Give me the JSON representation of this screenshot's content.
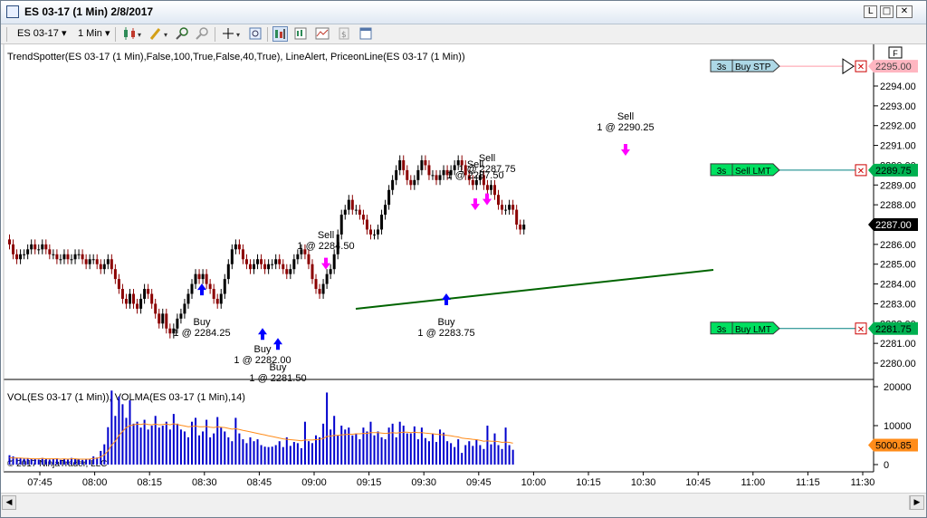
{
  "window": {
    "title": "ES 03-17 (1 Min)  2/8/2017",
    "btn_min": "L",
    "btn_max": "□",
    "btn_close": "✕"
  },
  "toolbar": {
    "instrument": "ES 03-17",
    "interval": "1 Min",
    "dropdown_arrow": "▾",
    "icons": [
      "candlestick-style-icon",
      "pencil-draw-icon",
      "zoom-in-icon",
      "zoom-out-icon",
      "crosshair-icon",
      "magnify-icon",
      "chart-trader-icon",
      "data-box-icon",
      "indicators-icon",
      "strategies-icon",
      "properties-icon"
    ]
  },
  "indicator_label": "TrendSpotter(ES 03-17 (1 Min),False,100,True,False,40,True), LineAlert, PriceonLine(ES 03-17 (1 Min))",
  "volume_label": "VOL(ES 03-17 (1 Min)), VOLMA(ES 03-17 (1 Min),14)",
  "copyright": "© 2017 NinjaTrader, LLC",
  "f_button": "F",
  "price_axis": {
    "ticks": [
      "2294.00",
      "2293.00",
      "2292.00",
      "2291.00",
      "2290.00",
      "2289.00",
      "2288.00",
      "2287.00",
      "2286.00",
      "2285.00",
      "2284.00",
      "2283.00",
      "2282.00",
      "2281.00",
      "2280.00"
    ],
    "last_price": "2287.00",
    "last_price_color": "#000000"
  },
  "volume_axis": {
    "ticks": [
      "20000",
      "10000",
      "0"
    ],
    "volma_value": "5000.85",
    "volma_color": "#ff8c1a"
  },
  "time_axis": [
    "07:45",
    "08:00",
    "08:15",
    "08:30",
    "08:45",
    "09:00",
    "09:15",
    "09:30",
    "09:45",
    "10:00",
    "10:15",
    "10:30",
    "10:45",
    "11:00",
    "11:15",
    "11:30"
  ],
  "orders": [
    {
      "qty": "3s",
      "type": "Buy STP",
      "price": "2295.00",
      "fill": "#add8e6",
      "price_fill": "#ffb6c1"
    },
    {
      "qty": "3s",
      "type": "Sell LMT",
      "price": "2289.75",
      "fill": "#00e060",
      "price_fill": "#00b050"
    },
    {
      "qty": "3s",
      "type": "Buy LMT",
      "price": "2281.75",
      "fill": "#00e060",
      "price_fill": "#00b050"
    }
  ],
  "order_cancel_glyph": "✕",
  "signals": [
    {
      "side": "Buy",
      "text": "1 @ 2284.25"
    },
    {
      "side": "Buy",
      "text": "1 @ 2282.00"
    },
    {
      "side": "Buy",
      "text": "1 @ 2281.50"
    },
    {
      "side": "Sell",
      "text": "1 @ 2284.50"
    },
    {
      "side": "Buy",
      "text": "1 @ 2283.75"
    },
    {
      "side": "Sell",
      "text": "1 @ 2287.50"
    },
    {
      "side": "Sell",
      "text": "1 @ 2287.75"
    },
    {
      "side": "Sell",
      "text": "1 @ 2290.25"
    }
  ],
  "trendline_color": "#006400",
  "up_color": "#000000",
  "down_color": "#8b0000",
  "volume_bar_color": "#0000cd",
  "scroll": {
    "left": "◀",
    "right": "▶"
  },
  "chart_data": {
    "type": "candlestick",
    "x": [
      "07:45",
      "08:00",
      "08:15",
      "08:30",
      "08:45",
      "09:00",
      "09:15",
      "09:30",
      "09:45",
      "10:00",
      "10:15",
      "10:30",
      "10:45",
      "11:00",
      "11:15",
      "11:30"
    ],
    "ylim": [
      2279.5,
      2295.5
    ],
    "close_path": [
      2286.0,
      2285.5,
      2285.25,
      2285.5,
      2285.5,
      2285.75,
      2286.0,
      2285.75,
      2285.75,
      2286.0,
      2285.75,
      2285.5,
      2285.5,
      2285.25,
      2285.25,
      2285.5,
      2285.25,
      2285.25,
      2285.5,
      2285.5,
      2285.25,
      2285.0,
      2285.25,
      2285.25,
      2285.0,
      2284.75,
      2285.0,
      2285.25,
      2284.75,
      2284.25,
      2283.75,
      2283.25,
      2283.0,
      2283.5,
      2283.0,
      2282.75,
      2283.25,
      2283.75,
      2283.5,
      2283.0,
      2282.5,
      2282.0,
      2282.5,
      2281.75,
      2281.5,
      2281.75,
      2282.25,
      2282.5,
      2283.0,
      2283.5,
      2284.0,
      2284.5,
      2284.25,
      2284.5,
      2284.0,
      2283.75,
      2283.25,
      2283.0,
      2283.5,
      2284.25,
      2285.0,
      2285.75,
      2286.0,
      2285.75,
      2285.25,
      2285.0,
      2284.75,
      2285.0,
      2285.25,
      2285.0,
      2284.75,
      2285.0,
      2285.0,
      2285.25,
      2285.0,
      2284.75,
      2284.5,
      2284.75,
      2285.25,
      2285.5,
      2285.75,
      2285.5,
      2285.0,
      2284.25,
      2283.75,
      2283.5,
      2284.0,
      2284.5,
      2284.75,
      2285.5,
      2286.5,
      2287.5,
      2287.75,
      2288.25,
      2287.75,
      2287.75,
      2287.5,
      2287.25,
      2286.75,
      2286.5,
      2286.5,
      2286.75,
      2287.5,
      2288.0,
      2288.75,
      2289.25,
      2289.75,
      2290.25,
      2289.75,
      2289.25,
      2289.0,
      2289.25,
      2289.75,
      2290.25,
      2290.0,
      2289.5,
      2289.5,
      2289.25,
      2289.5,
      2289.75,
      2289.5,
      2289.75,
      2290.0,
      2290.25,
      2290.0,
      2289.5,
      2289.25,
      2289.0,
      2289.25,
      2289.5,
      2289.0,
      2288.75,
      2289.0,
      2288.5,
      2288.0,
      2287.75,
      2287.75,
      2288.0,
      2287.75,
      2287.0,
      2286.75,
      2287.0
    ],
    "volume_path": [
      2400,
      2100,
      1800,
      1700,
      1500,
      1600,
      1400,
      1500,
      1300,
      1700,
      1400,
      1300,
      1500,
      1600,
      1200,
      1400,
      1300,
      1700,
      1500,
      1400,
      1200,
      1300,
      1400,
      2100,
      1800,
      3500,
      5200,
      9600,
      19000,
      12500,
      17500,
      15500,
      12000,
      16500,
      10500,
      11000,
      9500,
      11500,
      9000,
      10000,
      12500,
      9500,
      10000,
      11000,
      9000,
      13000,
      10500,
      9000,
      8500,
      7000,
      11000,
      12000,
      7500,
      8500,
      11500,
      7000,
      8000,
      12200,
      9500,
      8500,
      7000,
      6000,
      12000,
      8000,
      6500,
      5500,
      7000,
      6000,
      6500,
      5000,
      4600,
      4500,
      4600,
      5000,
      6000,
      4500,
      7000,
      4800,
      5800,
      5500,
      4200,
      11000,
      6000,
      5500,
      7500,
      7000,
      10500,
      18500,
      9000,
      12500,
      7500,
      10000,
      9000,
      9500,
      7500,
      8000,
      6500,
      9500,
      8500,
      11000,
      7500,
      8500,
      7000,
      6500,
      9500,
      10500,
      7000,
      11000,
      10000,
      8000,
      8000,
      9800,
      6500,
      9500,
      6800,
      6000,
      8000,
      5800,
      9000,
      8200,
      6000,
      5500,
      4500,
      6500,
      3000,
      5000,
      6000,
      4800,
      6500,
      5000,
      4000,
      10000,
      5200,
      8000,
      5000,
      4000,
      9500,
      5000,
      3800
    ],
    "volma_path": [
      1800,
      1700,
      1700,
      1700,
      1600,
      1600,
      1500,
      1500,
      1500,
      1600,
      1500,
      1500,
      1500,
      1500,
      1400,
      1500,
      1400,
      1500,
      1500,
      1400,
      1400,
      1400,
      1400,
      1600,
      1600,
      2000,
      2500,
      3500,
      5000,
      6000,
      7500,
      8500,
      9500,
      10000,
      10200,
      10400,
      10300,
      10500,
      10300,
      10200,
      10400,
      10200,
      10300,
      10400,
      10200,
      10500,
      10300,
      10100,
      9900,
      9700,
      9800,
      9900,
      9700,
      9700,
      9800,
      9600,
      9500,
      9700,
      9600,
      9500,
      9300,
      9100,
      9200,
      9000,
      8800,
      8600,
      8400,
      8200,
      8000,
      7800,
      7600,
      7400,
      7200,
      7000,
      6800,
      6600,
      6500,
      6400,
      6300,
      6200,
      6100,
      6300,
      6300,
      6300,
      6400,
      6500,
      6700,
      7200,
      7300,
      7500,
      7500,
      7600,
      7700,
      7800,
      7800,
      7900,
      7900,
      8000,
      8000,
      8200,
      8200,
      8200,
      8100,
      8000,
      8100,
      8200,
      8100,
      8200,
      8300,
      8300,
      8200,
      8300,
      8200,
      8200,
      8100,
      8000,
      7900,
      7800,
      7700,
      7600,
      7500,
      7400,
      7200,
      7100,
      6800,
      6700,
      6600,
      6500,
      6400,
      6200,
      6000,
      6100,
      6000,
      6000,
      5900,
      5700,
      5800,
      5700,
      5500
    ]
  }
}
